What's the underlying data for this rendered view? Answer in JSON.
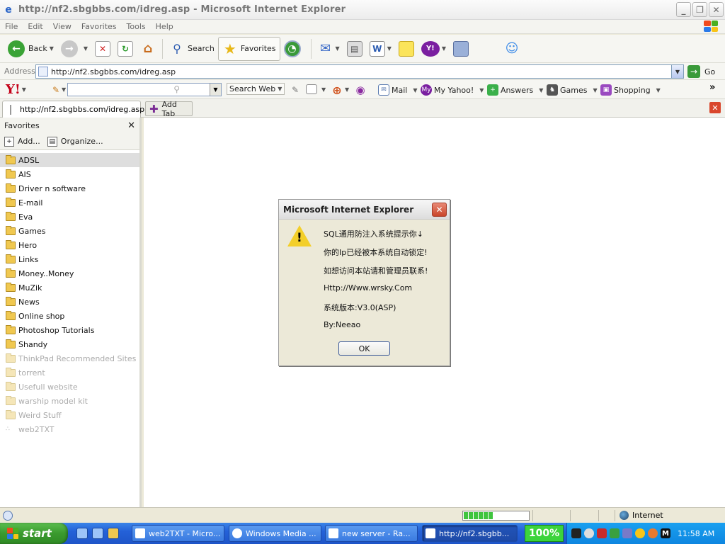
{
  "window": {
    "title": "http://nf2.sbgbbs.com/idreg.asp - Microsoft Internet Explorer",
    "minimize": "_",
    "restore": "❐",
    "close": "✕"
  },
  "menu": [
    "File",
    "Edit",
    "View",
    "Favorites",
    "Tools",
    "Help"
  ],
  "toolbar": {
    "back": "Back",
    "search": "Search",
    "favorites": "Favorites"
  },
  "address": {
    "label": "Address",
    "url": "http://nf2.sbgbbs.com/idreg.asp",
    "go": "Go"
  },
  "yahoo": {
    "logo": "Y!",
    "search_web": "Search Web",
    "mail": "Mail",
    "my_yahoo": "My Yahoo!",
    "answers": "Answers",
    "games": "Games",
    "shopping": "Shopping",
    "more": "»"
  },
  "tabs": {
    "current": "http://nf2.sbgbbs.com/idreg.asp",
    "add_tab": "Add Tab"
  },
  "favorites_pane": {
    "title": "Favorites",
    "close": "✕",
    "add": "Add...",
    "organize": "Organize...",
    "items": [
      {
        "label": "ADSL",
        "style": "selected"
      },
      {
        "label": "AIS",
        "style": "normal"
      },
      {
        "label": "Driver n software",
        "style": "normal"
      },
      {
        "label": "E-mail",
        "style": "normal"
      },
      {
        "label": "Eva",
        "style": "normal"
      },
      {
        "label": "Games",
        "style": "normal"
      },
      {
        "label": "Hero",
        "style": "normal"
      },
      {
        "label": "Links",
        "style": "normal"
      },
      {
        "label": "Money..Money",
        "style": "normal"
      },
      {
        "label": "MuZik",
        "style": "normal"
      },
      {
        "label": "News",
        "style": "normal"
      },
      {
        "label": "Online shop",
        "style": "normal"
      },
      {
        "label": "Photoshop Tutorials",
        "style": "normal"
      },
      {
        "label": "Shandy",
        "style": "normal"
      },
      {
        "label": "ThinkPad Recommended Sites",
        "style": "faded"
      },
      {
        "label": "torrent",
        "style": "faded"
      },
      {
        "label": "Usefull website",
        "style": "faded"
      },
      {
        "label": "warship model kit",
        "style": "faded"
      },
      {
        "label": "Weird Stuff",
        "style": "faded"
      },
      {
        "label": "web2TXT",
        "style": "faded-link"
      }
    ]
  },
  "dialog": {
    "title": "Microsoft Internet Explorer",
    "lines": [
      "SQL通用防注入系统提示你↓",
      "你的Ip已经被本系统自动锁定!",
      "如想访问本站请和管理员联系!",
      "Http://Www.wrsky.Com",
      "系统版本:V3.0(ASP)",
      "By:Neeao"
    ],
    "ok": "OK",
    "close": "✕",
    "warning_glyph": "!"
  },
  "status": {
    "zone": "Internet",
    "progress_fraction": 0.45
  },
  "taskbar": {
    "start": "start",
    "tasks": [
      {
        "label": "web2TXT - Micro...",
        "active": false
      },
      {
        "label": "Windows Media ...",
        "active": false
      },
      {
        "label": "new server - Ra...",
        "active": false
      },
      {
        "label": "http://nf2.sbgbb...",
        "active": true
      }
    ],
    "zoom": "100%",
    "clock": "11:58 AM"
  },
  "colors": {
    "xp_red": "#f04a1c",
    "xp_green": "#4caf20",
    "xp_blue": "#2a7ae8",
    "xp_yellow": "#f8c418"
  }
}
